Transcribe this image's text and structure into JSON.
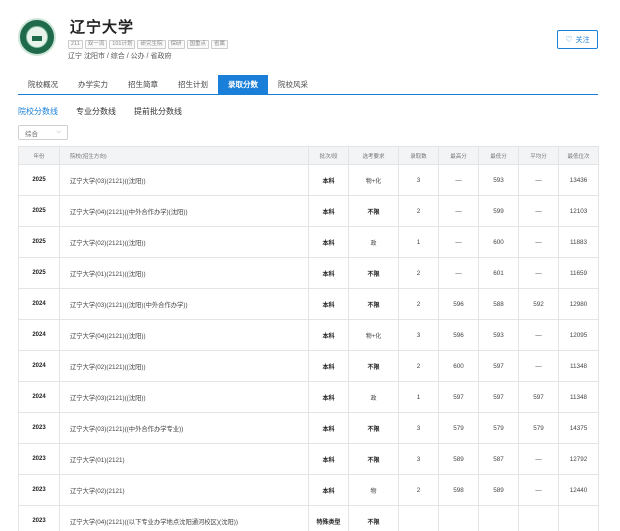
{
  "header": {
    "name": "辽宁大学",
    "tags": [
      "211",
      "双一流",
      "101计划",
      "研究生院",
      "保研",
      "国重点",
      "省属"
    ],
    "location": "辽宁 沈阳市 / 综合 / 公办 / 省政府",
    "follow_label": "关注",
    "follow_icon": "heart-icon"
  },
  "tabs": [
    "院校概况",
    "办学实力",
    "招生简章",
    "招生计划",
    "录取分数",
    "院校风采"
  ],
  "subtabs": [
    "院校分数线",
    "专业分数线",
    "提前批分数线"
  ],
  "filter": {
    "selected": "综合"
  },
  "table": {
    "headers": [
      "年份",
      "院校(招生方向)",
      "批次/段",
      "选考要求",
      "录取数",
      "最高分",
      "最低分",
      "平均分",
      "最低位次"
    ],
    "rows": [
      [
        "2025",
        "辽宁大学(03)(2121)((沈阳))",
        "本科",
        "物+化",
        "3",
        "—",
        "593",
        "—",
        "13436"
      ],
      [
        "2025",
        "辽宁大学(04)(2121)((中外合作办学)(沈阳))",
        "本科",
        "不限",
        "2",
        "—",
        "599",
        "—",
        "12103"
      ],
      [
        "2025",
        "辽宁大学(02)(2121)((沈阳))",
        "本科",
        "政",
        "1",
        "—",
        "600",
        "—",
        "11883"
      ],
      [
        "2025",
        "辽宁大学(01)(2121)((沈阳))",
        "本科",
        "不限",
        "2",
        "—",
        "601",
        "—",
        "11659"
      ],
      [
        "2024",
        "辽宁大学(03)(2121)((沈阳)(中外合作办学))",
        "本科",
        "不限",
        "2",
        "596",
        "588",
        "592",
        "12980"
      ],
      [
        "2024",
        "辽宁大学(04)(2121)((沈阳))",
        "本科",
        "物+化",
        "3",
        "596",
        "593",
        "—",
        "12095"
      ],
      [
        "2024",
        "辽宁大学(02)(2121)((沈阳))",
        "本科",
        "不限",
        "2",
        "600",
        "597",
        "—",
        "11348"
      ],
      [
        "2024",
        "辽宁大学(03)(2121)((沈阳))",
        "本科",
        "政",
        "1",
        "597",
        "597",
        "597",
        "11348"
      ],
      [
        "2023",
        "辽宁大学(03)(2121)((中外合作办学专业))",
        "本科",
        "不限",
        "3",
        "579",
        "579",
        "579",
        "14375"
      ],
      [
        "2023",
        "辽宁大学(01)(2121)",
        "本科",
        "不限",
        "3",
        "589",
        "587",
        "—",
        "12792"
      ],
      [
        "2023",
        "辽宁大学(02)(2121)",
        "本科",
        "物",
        "2",
        "598",
        "589",
        "—",
        "12440"
      ],
      [
        "2023",
        "辽宁大学(04)(2121)((以下专业办学地点沈阳通河校区)(沈阳))",
        "特殊类型",
        "不限",
        "",
        "",
        "",
        "",
        ""
      ]
    ]
  }
}
